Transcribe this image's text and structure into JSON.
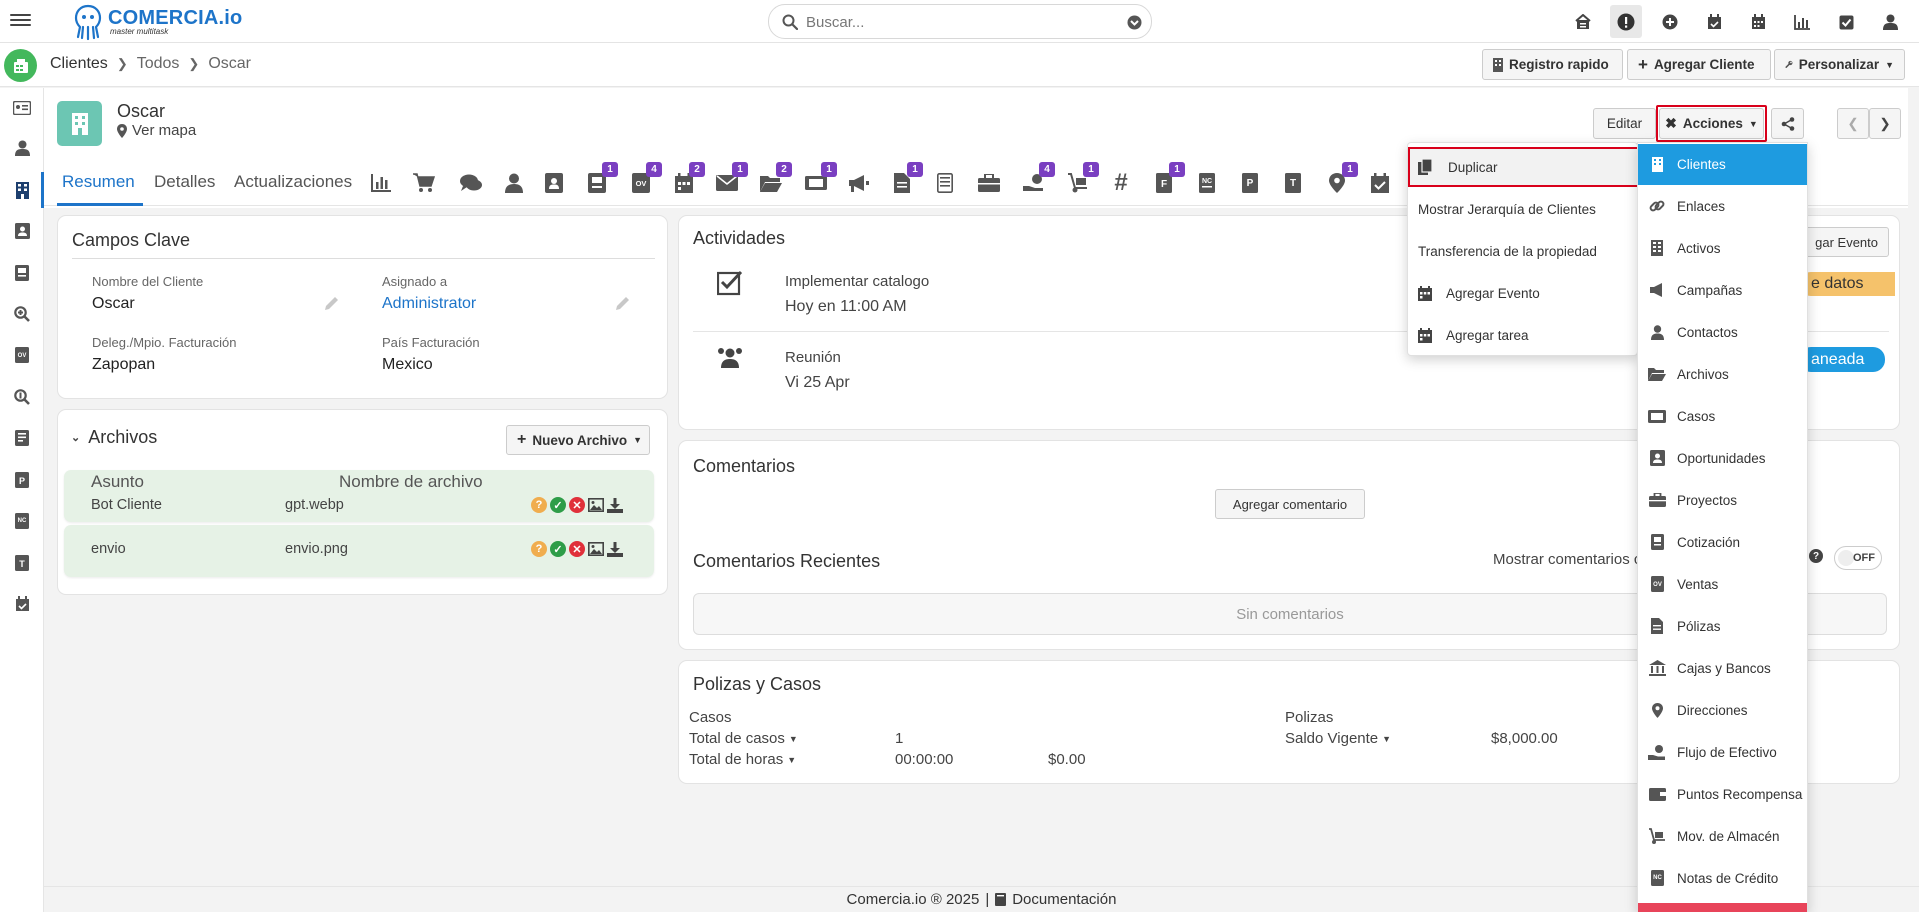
{
  "app": {
    "name": "COMERCIA.io",
    "tagline": "master multitask"
  },
  "search": {
    "placeholder": "Buscar..."
  },
  "breadcrumb": {
    "root": "Clientes",
    "level": "Todos",
    "current": "Oscar"
  },
  "header_actions": {
    "quick": "Registro rapido",
    "add": "Agregar Cliente",
    "customize": "Personalizar"
  },
  "record": {
    "name": "Oscar",
    "map": "Ver mapa"
  },
  "record_actions": {
    "edit": "Editar",
    "actions": "Acciones"
  },
  "tabs": [
    "Resumen",
    "Detalles",
    "Actualizaciones"
  ],
  "tab_badges": {
    "b1": "1",
    "b2": "4",
    "b3": "2",
    "b4": "1",
    "b5": "2",
    "b6": "1",
    "b7": "1",
    "b8": "4",
    "b9": "1",
    "b10": "1",
    "b11": "1"
  },
  "key_fields": {
    "title": "Campos Clave",
    "fields": [
      {
        "label": "Nombre del Cliente",
        "value": "Oscar"
      },
      {
        "label": "Asignado a",
        "value": "Administrator"
      },
      {
        "label": "Deleg./Mpio. Facturación",
        "value": "Zapopan"
      },
      {
        "label": "País Facturación",
        "value": "Mexico"
      }
    ]
  },
  "files": {
    "title": "Archivos",
    "new_button": "Nuevo Archivo",
    "headers": [
      "Asunto",
      "Nombre de archivo"
    ],
    "rows": [
      {
        "subject": "Bot Cliente",
        "filename": "gpt.webp"
      },
      {
        "subject": "envio",
        "filename": "envio.png"
      }
    ]
  },
  "activities": {
    "title": "Actividades",
    "add_event": "gar Evento",
    "items": [
      {
        "title": "Implementar catalogo",
        "when": "Hoy en 11:00 AM",
        "badge": "e datos"
      },
      {
        "title": "Reunión",
        "when": "Vi 25 Apr",
        "badge": "aneada"
      }
    ]
  },
  "comments": {
    "title": "Comentarios",
    "add": "Agregar comentario",
    "recent_title": "Comentarios Recientes",
    "show_label": "Mostrar comentarios c",
    "toggle": "OFF",
    "empty": "Sin comentarios"
  },
  "policies": {
    "title": "Polizas y Casos",
    "cases_label": "Casos",
    "total_cases_label": "Total de casos",
    "total_cases_value": "1",
    "total_hours_label": "Total de horas",
    "total_hours_value": "00:00:00",
    "total_hours_amount": "$0.00",
    "policies_label": "Polizas",
    "balance_label": "Saldo Vigente",
    "balance_value": "$8,000.00"
  },
  "actions_menu": [
    "Duplicar",
    "Mostrar Jerarquía de Clientes",
    "Transferencia de la propiedad",
    "Agregar Evento",
    "Agregar tarea"
  ],
  "modules_menu": [
    "Clientes",
    "Enlaces",
    "Activos",
    "Campañas",
    "Contactos",
    "Archivos",
    "Casos",
    "Oportunidades",
    "Proyectos",
    "Cotización",
    "Ventas",
    "Pólizas",
    "Cajas y Bancos",
    "Direcciones",
    "Flujo de Efectivo",
    "Puntos Recompensa",
    "Mov. de Almacén",
    "Notas de Crédito"
  ],
  "footer": {
    "copyright": "Comercia.io ® 2025",
    "docs": "Documentación"
  },
  "colors": {
    "primary": "#1d74c9",
    "badge": "#7a3fc1",
    "accent_green": "#43b85c",
    "highlight": "#d9001b",
    "file_row": "#e6f2e6"
  }
}
